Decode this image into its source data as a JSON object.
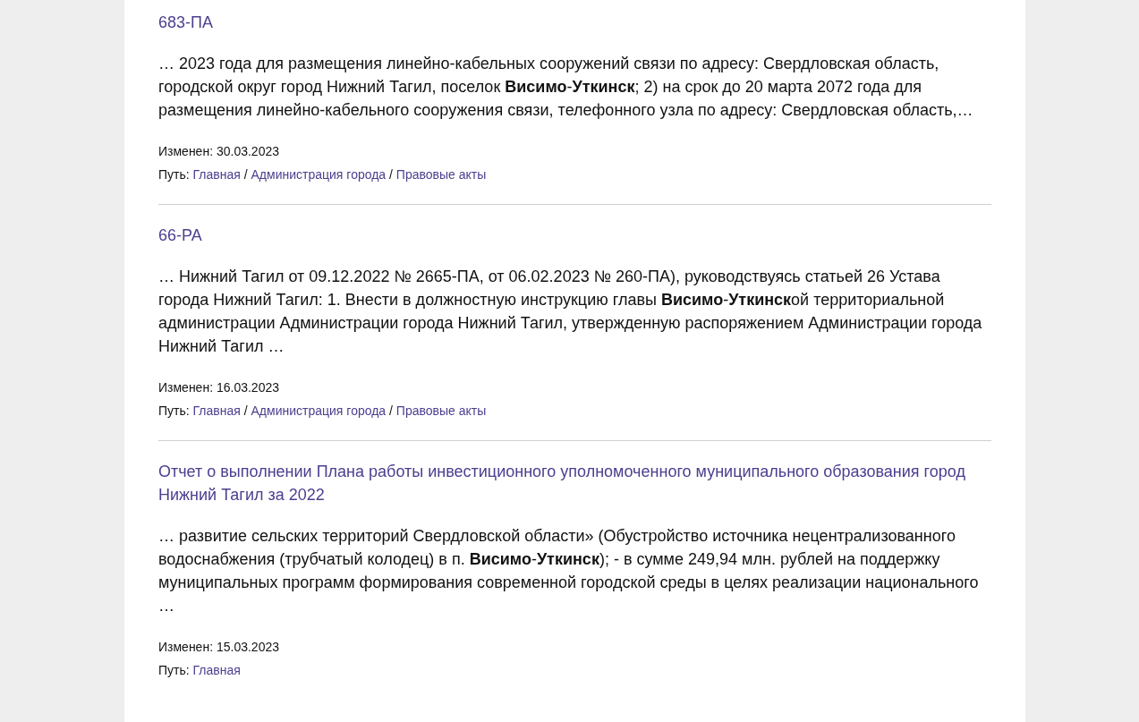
{
  "results": [
    {
      "title": "683-ПА",
      "snippet": "… 2023 года для размещения линейно-кабельных сооружений связи по адресу: Свердловская область, городской округ город Нижний Тагил, поселок **Висимо**-**Уткинск**; 2) на срок до 20 марта 2072 года для размещения линейно-кабельного сооружения связи, телефонного узла по адресу: Свердловская область,…",
      "modified_label": "Изменен:",
      "modified": "30.03.2023",
      "path_label": "Путь:",
      "path_separator": "/",
      "path": [
        "Главная",
        "Администрация города",
        "Правовые акты"
      ]
    },
    {
      "title": "66-РА",
      "snippet": "… Нижний Тагил от 09.12.2022 № 2665-ПА, от 06.02.2023 № 260-ПА), руководствуясь статьей 26 Устава города Нижний Тагил: 1. Внести в должностную инструкцию главы **Висимо**-**Уткинск**ой территориальной администрации Администрации города Нижний Тагил, утвержденную распоряжением Администрации города Нижний Тагил …",
      "modified_label": "Изменен:",
      "modified": "16.03.2023",
      "path_label": "Путь:",
      "path_separator": "/",
      "path": [
        "Главная",
        "Администрация города",
        "Правовые акты"
      ]
    },
    {
      "title": "Отчет о выполнении Плана работы инвестиционного уполномоченного муниципального образования город Нижний Тагил за 2022",
      "snippet": "… развитие сельских территорий Свердловской области» (Обустройство источника нецентрализованного водоснабжения (трубчатый колодец) в п. **Висимо**-**Уткинск**); - в сумме 249,94 млн. рублей на поддержку муниципальных программ формирования современной городской среды в целях реализации национального …",
      "modified_label": "Изменен:",
      "modified": "15.03.2023",
      "path_label": "Путь:",
      "path": [
        "Главная"
      ]
    }
  ]
}
